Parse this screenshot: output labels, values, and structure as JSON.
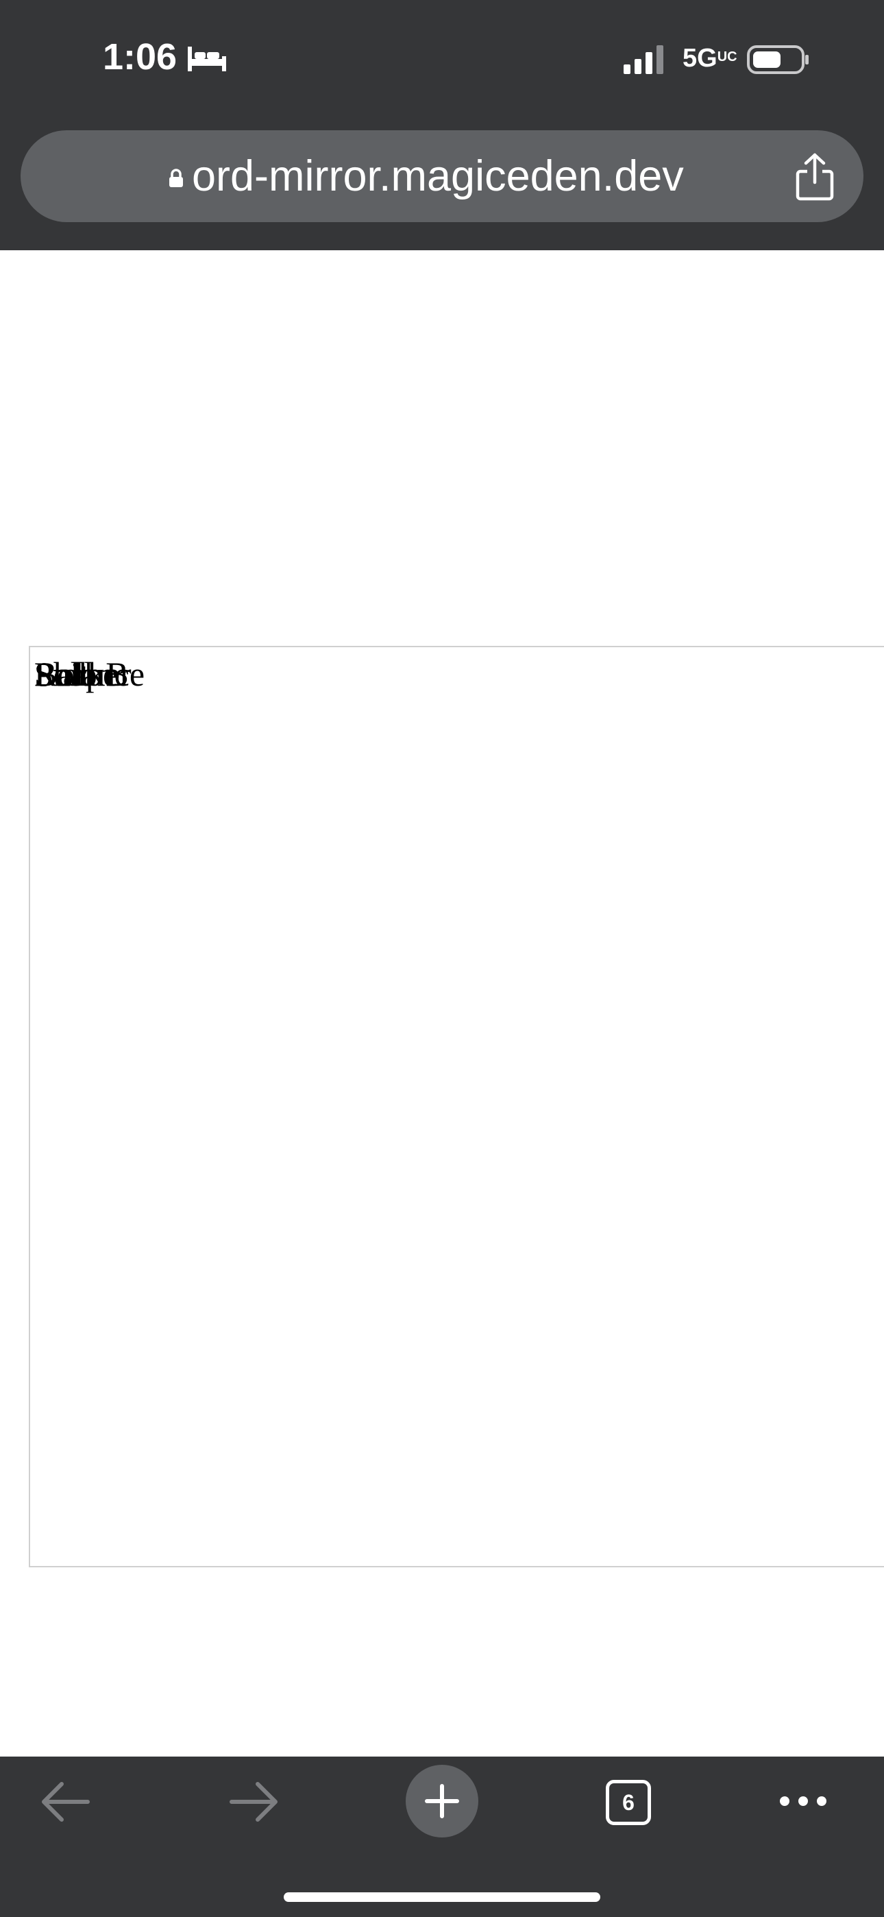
{
  "status_bar": {
    "time": "1:06",
    "network": "5G",
    "network_suffix": "UC"
  },
  "browser": {
    "url": "ord-mirror.magiceden.dev",
    "tab_count": "6"
  },
  "content": {
    "overlapping_texts": [
      "Stalker",
      "Balance",
      "Shape",
      "Roll",
      "Polo B",
      "Suit"
    ]
  },
  "colors": {
    "chrome": "#353638",
    "urlbar": "#5f6164"
  }
}
